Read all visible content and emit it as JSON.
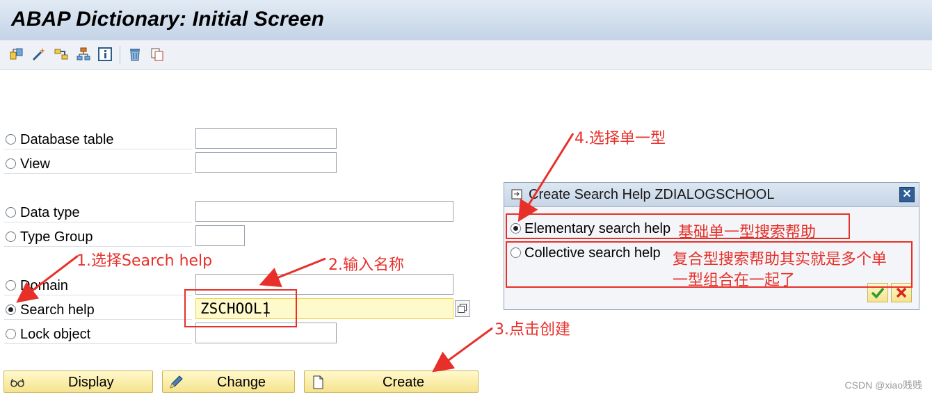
{
  "window": {
    "title": "ABAP Dictionary: Initial Screen"
  },
  "toolbar": {
    "icons": [
      "other-object-icon",
      "magic-wand-icon",
      "where-used-icon",
      "hierarchy-icon",
      "info-icon",
      "delete-icon",
      "copy-icon"
    ]
  },
  "objects": [
    {
      "label": "Database table",
      "selected": false,
      "value": ""
    },
    {
      "label": "View",
      "selected": false,
      "value": ""
    },
    {
      "label": "Data type",
      "selected": false,
      "value": ""
    },
    {
      "label": "Type Group",
      "selected": false,
      "value": ""
    },
    {
      "label": "Domain",
      "selected": false,
      "value": ""
    },
    {
      "label": "Search help",
      "selected": true,
      "value": "ZSCHOOL1"
    },
    {
      "label": "Lock object",
      "selected": false,
      "value": ""
    }
  ],
  "buttons": {
    "display": "Display",
    "change": "Change",
    "create": "Create"
  },
  "dialog": {
    "title": "Create Search Help ZDIALOGSCHOOL",
    "close": "✕",
    "options": [
      {
        "label": "Elementary search help",
        "selected": true
      },
      {
        "label": "Collective search help",
        "selected": false
      }
    ]
  },
  "annotations": {
    "step1": "1.选择Search help",
    "step2": "2.输入名称",
    "step3": "3.点击创建",
    "step4": "4.选择单一型",
    "elementary_note": "基础单一型搜索帮助",
    "collective_note_line1": "复合型搜索帮助其实就是多个单",
    "collective_note_line2": "一型组合在一起了"
  },
  "watermark": "CSDN @xiao贱贱",
  "colors": {
    "annotation": "#e8302a",
    "active_field": "#fffacc",
    "button": "#f6e38e"
  }
}
